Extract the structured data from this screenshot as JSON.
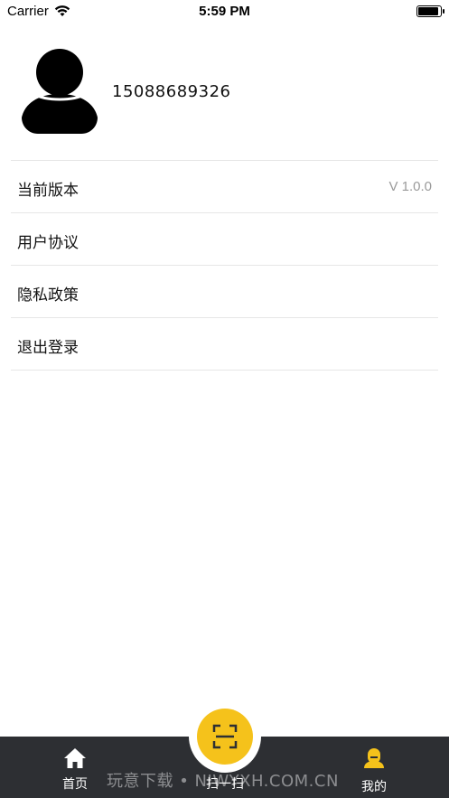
{
  "status_bar": {
    "carrier": "Carrier",
    "time": "5:59 PM"
  },
  "profile": {
    "phone": "15088689326"
  },
  "menu": {
    "items": [
      {
        "label": "当前版本",
        "value": "V 1.0.0"
      },
      {
        "label": "用户协议"
      },
      {
        "label": "隐私政策"
      },
      {
        "label": "退出登录"
      }
    ]
  },
  "tabbar": {
    "home": {
      "label": "首页",
      "icon": "home-icon"
    },
    "scan": {
      "label": "扫一扫",
      "icon": "scan-icon"
    },
    "mine": {
      "label": "我的",
      "icon": "user-icon"
    },
    "accent_color": "#f5c21b",
    "background_color": "#2d2f33"
  },
  "watermark": "玩意下载 • NIWYXH.COM.CN"
}
